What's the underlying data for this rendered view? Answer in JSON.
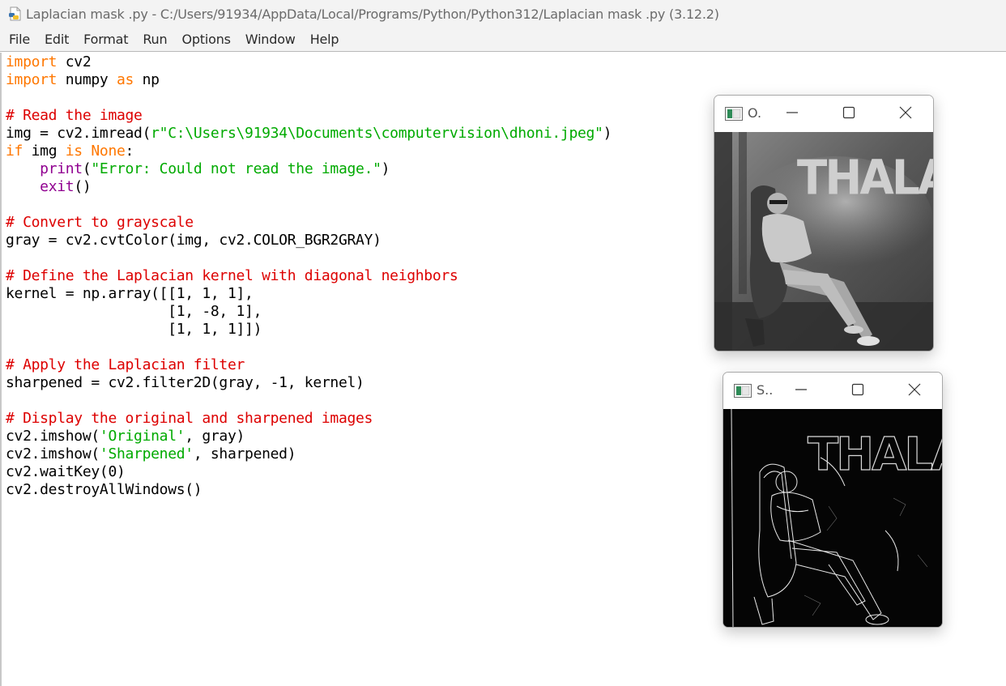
{
  "window": {
    "title": "Laplacian mask .py - C:/Users/91934/AppData/Local/Programs/Python/Python312/Laplacian mask .py (3.12.2)"
  },
  "menu": [
    "File",
    "Edit",
    "Format",
    "Run",
    "Options",
    "Window",
    "Help"
  ],
  "code_lines": [
    [
      {
        "t": "import",
        "c": "kw"
      },
      {
        "t": " cv2"
      }
    ],
    [
      {
        "t": "import",
        "c": "kw"
      },
      {
        "t": " numpy "
      },
      {
        "t": "as",
        "c": "kw"
      },
      {
        "t": " np"
      }
    ],
    [],
    [
      {
        "t": "# Read the image",
        "c": "cm"
      }
    ],
    [
      {
        "t": "img = cv2.imread("
      },
      {
        "t": "r\"C:\\Users\\91934\\Documents\\computervision\\dhoni.jpeg\"",
        "c": "st"
      },
      {
        "t": ")"
      }
    ],
    [
      {
        "t": "if",
        "c": "kw"
      },
      {
        "t": " img "
      },
      {
        "t": "is",
        "c": "kw"
      },
      {
        "t": " "
      },
      {
        "t": "None",
        "c": "kw"
      },
      {
        "t": ":"
      }
    ],
    [
      {
        "t": "    "
      },
      {
        "t": "print",
        "c": "bi"
      },
      {
        "t": "("
      },
      {
        "t": "\"Error: Could not read the image.\"",
        "c": "st"
      },
      {
        "t": ")"
      }
    ],
    [
      {
        "t": "    "
      },
      {
        "t": "exit",
        "c": "bi"
      },
      {
        "t": "()"
      }
    ],
    [],
    [
      {
        "t": "# Convert to grayscale",
        "c": "cm"
      }
    ],
    [
      {
        "t": "gray = cv2.cvtColor(img, cv2.COLOR_BGR2GRAY)"
      }
    ],
    [],
    [
      {
        "t": "# Define the Laplacian kernel with diagonal neighbors",
        "c": "cm"
      }
    ],
    [
      {
        "t": "kernel = np.array([[1, 1, 1],"
      }
    ],
    [
      {
        "t": "                   [1, -8, 1],"
      }
    ],
    [
      {
        "t": "                   [1, 1, 1]])"
      }
    ],
    [],
    [
      {
        "t": "# Apply the Laplacian filter",
        "c": "cm"
      }
    ],
    [
      {
        "t": "sharpened = cv2.filter2D(gray, -1, kernel)"
      }
    ],
    [],
    [
      {
        "t": "# Display the original and sharpened images",
        "c": "cm"
      }
    ],
    [
      {
        "t": "cv2.imshow("
      },
      {
        "t": "'Original'",
        "c": "st"
      },
      {
        "t": ", gray)"
      }
    ],
    [
      {
        "t": "cv2.imshow("
      },
      {
        "t": "'Sharpened'",
        "c": "st"
      },
      {
        "t": ", sharpened)"
      }
    ],
    [
      {
        "t": "cv2.waitKey(0)"
      }
    ],
    [
      {
        "t": "cv2.destroyAllWindows()"
      }
    ]
  ],
  "image_windows": {
    "original": {
      "title": "O.",
      "caption": "THALA"
    },
    "sharpened": {
      "title": "S..",
      "caption": "THALA"
    }
  },
  "colors": {
    "keyword": "#ff7700",
    "comment": "#dd0000",
    "string": "#00aa00",
    "builtin": "#900090"
  },
  "icons": [
    "python-file-icon",
    "opencv-window-icon",
    "minimize-icon",
    "maximize-icon",
    "close-icon"
  ]
}
